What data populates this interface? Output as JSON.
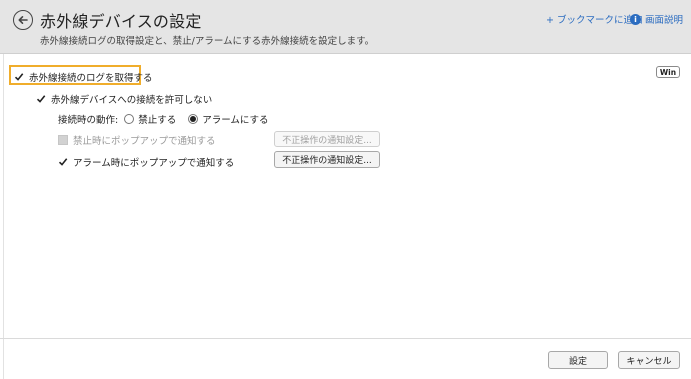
{
  "header": {
    "title": "赤外線デバイスの設定",
    "subtitle": "赤外線接続ログの取得設定と、禁止/アラームにする赤外線接続を設定します。",
    "bookmark": "+ ブックマークに追加",
    "help": "画面説明",
    "back_icon": "back-arrow-icon",
    "help_icon": "info-icon"
  },
  "badge": "Win",
  "settings": {
    "log": {
      "label": "赤外線接続のログを取得する",
      "checked": true
    },
    "deny": {
      "label": "赤外線デバイスへの接続を許可しない",
      "checked": true
    },
    "action": {
      "label": "接続時の動作:",
      "options": [
        {
          "label": "禁止する",
          "selected": false
        },
        {
          "label": "アラームにする",
          "selected": true
        }
      ]
    },
    "block_popup": {
      "label": "禁止時にポップアップで通知する",
      "checked": false,
      "disabled": true,
      "button": "不正操作の通知設定..."
    },
    "alarm_popup": {
      "label": "アラーム時にポップアップで通知する",
      "checked": true,
      "disabled": false,
      "button": "不正操作の通知設定..."
    }
  },
  "footer": {
    "ok": "設定",
    "cancel": "キャンセル"
  },
  "colors": {
    "header_bg": "#e5e5e5",
    "link": "#2b6cc0",
    "highlight": "#f0ad2b"
  }
}
